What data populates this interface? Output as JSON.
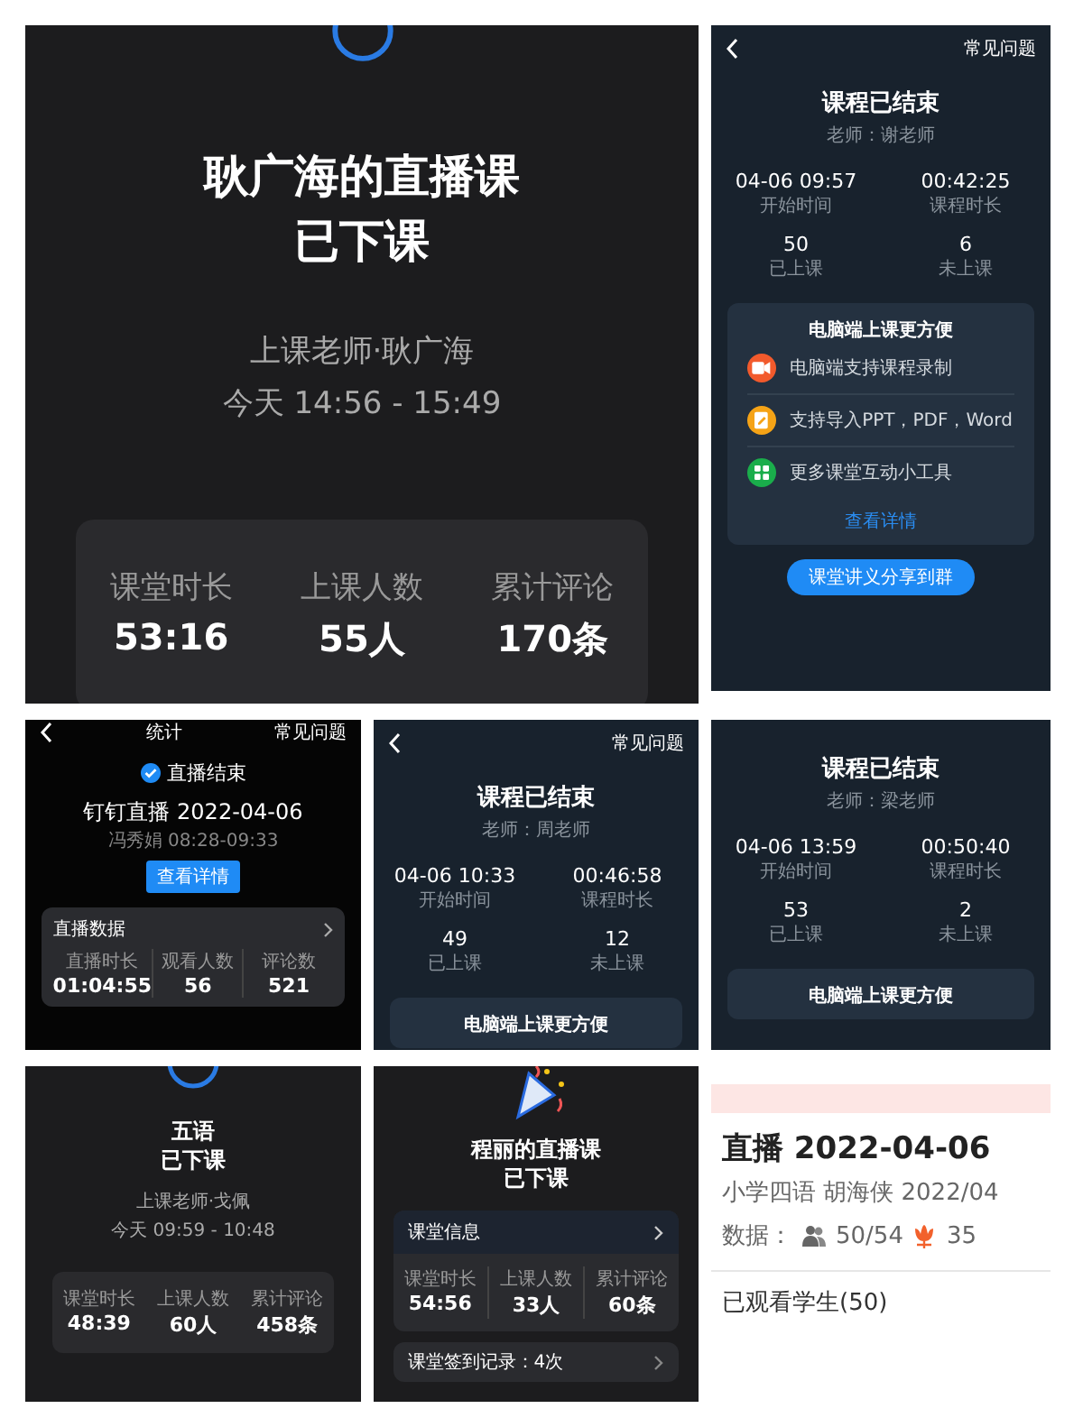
{
  "panels": [
    {
      "kind": "summary",
      "title_lines": [
        "耿广海的直播课",
        "已下课"
      ],
      "teacher": "上课老师·耿广海",
      "time": "今天 14:56 - 15:49",
      "stats": [
        {
          "label": "课堂时长",
          "value": "53:16"
        },
        {
          "label": "上课人数",
          "value": "55人"
        },
        {
          "label": "累计评论",
          "value": "170条"
        }
      ]
    },
    {
      "kind": "ended",
      "help": "常见问题",
      "title": "课程已结束",
      "teacher": "老师：谢老师",
      "stats": [
        {
          "value": "04-06 09:57",
          "label": "开始时间"
        },
        {
          "value": "00:42:25",
          "label": "课程时长"
        },
        {
          "value": "50",
          "label": "已上课"
        },
        {
          "value": "6",
          "label": "未上课"
        }
      ],
      "promo": {
        "title": "电脑端上课更方便",
        "features": [
          {
            "text": "电脑端支持课程录制",
            "color": "#f25a2c"
          },
          {
            "text": "支持导入PPT，PDF，Word",
            "color": "#f5a316"
          },
          {
            "text": "更多课堂互动小工具",
            "color": "#1aad4b"
          }
        ],
        "link": "查看详情"
      },
      "share_button": "课堂讲义分享到群"
    },
    {
      "kind": "live_stats",
      "nav_title": "统计",
      "help": "常见问题",
      "status": "直播结束",
      "title": "钉钉直播 2022-04-06",
      "subtitle": "冯秀娟 08:28-09:33",
      "details_button": "查看详情",
      "section": "直播数据",
      "stats": [
        {
          "label": "直播时长",
          "value": "01:04:55"
        },
        {
          "label": "观看人数",
          "value": "56"
        },
        {
          "label": "评论数",
          "value": "521"
        }
      ]
    },
    {
      "kind": "ended",
      "help": "常见问题",
      "title": "课程已结束",
      "teacher": "老师：周老师",
      "stats": [
        {
          "value": "04-06 10:33",
          "label": "开始时间"
        },
        {
          "value": "00:46:58",
          "label": "课程时长"
        },
        {
          "value": "49",
          "label": "已上课"
        },
        {
          "value": "12",
          "label": "未上课"
        }
      ],
      "promo": {
        "title": "电脑端上课更方便"
      }
    },
    {
      "kind": "ended",
      "title": "课程已结束",
      "teacher": "老师：梁老师",
      "stats": [
        {
          "value": "04-06 13:59",
          "label": "开始时间"
        },
        {
          "value": "00:50:40",
          "label": "课程时长"
        },
        {
          "value": "53",
          "label": "已上课"
        },
        {
          "value": "2",
          "label": "未上课"
        }
      ],
      "promo": {
        "title": "电脑端上课更方便"
      }
    },
    {
      "kind": "summary",
      "title_lines": [
        "五语",
        "已下课"
      ],
      "teacher": "上课老师·戈佩",
      "time": "今天 09:59 - 10:48",
      "stats": [
        {
          "label": "课堂时长",
          "value": "48:39"
        },
        {
          "label": "上课人数",
          "value": "60人"
        },
        {
          "label": "累计评论",
          "value": "458条"
        }
      ]
    },
    {
      "kind": "summary_card",
      "title_lines": [
        "程丽的直播课",
        "已下课"
      ],
      "section": "课堂信息",
      "stats": [
        {
          "label": "课堂时长",
          "value": "54:56"
        },
        {
          "label": "上课人数",
          "value": "33人"
        },
        {
          "label": "累计评论",
          "value": "60条"
        }
      ],
      "checkin": "课堂签到记录：4次"
    },
    {
      "kind": "list_detail",
      "title": "直播 2022-04-06",
      "subtitle": "小学四语 胡海侠 2022/04",
      "data_label": "数据：",
      "attendance": "50/54",
      "flowers": "35",
      "viewers": "已观看学生(50)"
    }
  ]
}
